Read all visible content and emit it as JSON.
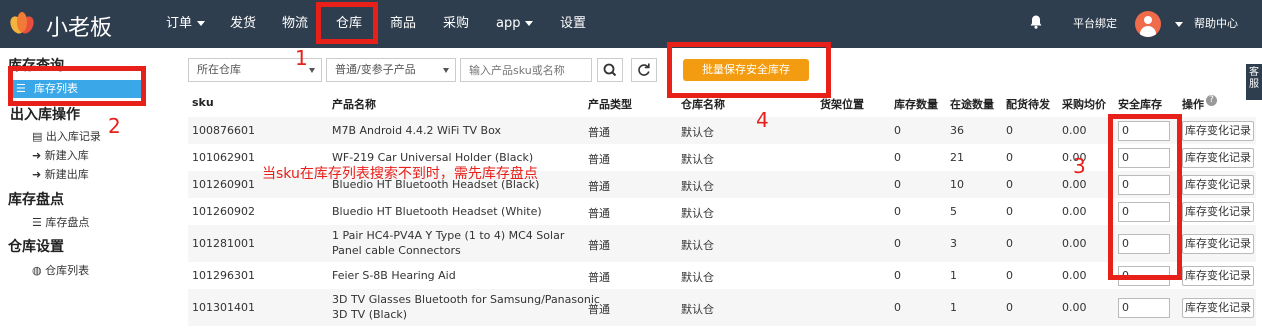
{
  "app": {
    "title": "小老板"
  },
  "nav": {
    "orders": "订单",
    "ship": "发货",
    "logistics": "物流",
    "warehouse": "仓库",
    "products": "商品",
    "purchase": "采购",
    "app": "app",
    "settings": "设置",
    "platform_bind": "平台绑定",
    "help": "帮助中心"
  },
  "sidebar": {
    "inventory_query": "库存查询",
    "inventory_list": "库存列表",
    "inout_ops": "出入库操作",
    "inout_records": "出入库记录",
    "new_in": "新建入库",
    "new_out": "新建出库",
    "stocktake": "库存盘点",
    "stocktake_item": "库存盘点",
    "warehouse_settings": "仓库设置",
    "warehouse_list": "仓库列表"
  },
  "filters": {
    "warehouse": "所在仓库",
    "product_type": "普通/变参子产品",
    "search_placeholder": "输入产品sku或名称"
  },
  "toolbar": {
    "batch_save": "批量保存安全库存"
  },
  "right_tab": "客服",
  "annotations": {
    "n1": "1",
    "n2": "2",
    "n3": "3",
    "n4": "4",
    "note": "当sku在库存列表搜索不到时，需先库存盘点"
  },
  "table": {
    "headers": {
      "sku": "sku",
      "name": "产品名称",
      "type": "产品类型",
      "warehouse": "仓库名称",
      "location": "货架位置",
      "stock": "库存数量",
      "transit": "在途数量",
      "pending": "配货待发",
      "avg_cost": "采购均价",
      "safety": "安全库存",
      "ops": "操作"
    },
    "log_label": "库存变化记录",
    "rows": [
      {
        "sku": "100876601",
        "name": "M7B Android 4.4.2 WiFi TV Box",
        "name2": "",
        "type": "普通",
        "warehouse": "默认仓",
        "stock": "0",
        "transit": "36",
        "pending": "0",
        "avg": "0.00",
        "safety": "0"
      },
      {
        "sku": "101062901",
        "name": "WF-219 Car Universal Holder (Black)",
        "name2": "",
        "type": "普通",
        "warehouse": "默认仓",
        "stock": "0",
        "transit": "21",
        "pending": "0",
        "avg": "0.00",
        "safety": "0"
      },
      {
        "sku": "101260901",
        "name": "Bluedio HT Bluetooth Headset (Black)",
        "name2": "",
        "type": "普通",
        "warehouse": "默认仓",
        "stock": "0",
        "transit": "10",
        "pending": "0",
        "avg": "0.00",
        "safety": "0"
      },
      {
        "sku": "101260902",
        "name": "Bluedio HT Bluetooth Headset (White)",
        "name2": "",
        "type": "普通",
        "warehouse": "默认仓",
        "stock": "0",
        "transit": "5",
        "pending": "0",
        "avg": "0.00",
        "safety": "0"
      },
      {
        "sku": "101281001",
        "name": "1 Pair HC4-PV4A Y Type (1 to 4) MC4 Solar",
        "name2": "Panel cable Connectors",
        "type": "普通",
        "warehouse": "默认仓",
        "stock": "0",
        "transit": "3",
        "pending": "0",
        "avg": "0.00",
        "safety": "0"
      },
      {
        "sku": "101296301",
        "name": "Feier S-8B Hearing Aid",
        "name2": "",
        "type": "普通",
        "warehouse": "默认仓",
        "stock": "0",
        "transit": "1",
        "pending": "0",
        "avg": "0.00",
        "safety": "0"
      },
      {
        "sku": "101301401",
        "name": "3D TV Glasses Bluetooth for Samsung/Panasonic",
        "name2": "3D TV (Black)",
        "type": "普通",
        "warehouse": "默认仓",
        "stock": "0",
        "transit": "1",
        "pending": "0",
        "avg": "0.00",
        "safety": "0"
      }
    ]
  }
}
